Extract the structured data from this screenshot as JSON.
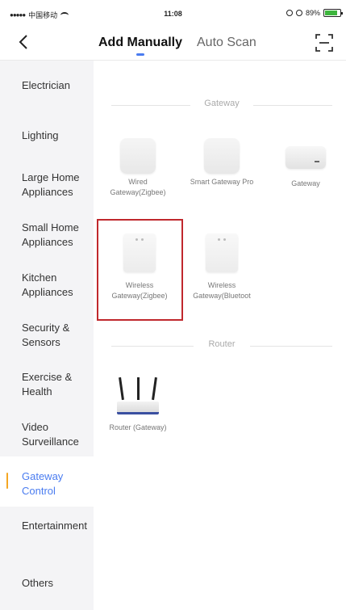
{
  "status_bar": {
    "carrier": "中国移动",
    "time": "11:08",
    "battery": "89%"
  },
  "nav": {
    "tabs": [
      {
        "label": "Add Manually",
        "active": true
      },
      {
        "label": "Auto Scan",
        "active": false
      }
    ],
    "icons": {
      "back": "chevron-left-icon",
      "scan": "scan-frame-icon"
    },
    "accent_color": "#4a7cf0"
  },
  "sidebar": {
    "items": [
      {
        "label": "Electrician",
        "active": false
      },
      {
        "label": "Lighting",
        "active": false
      },
      {
        "label": "Large Home Appliances",
        "active": false
      },
      {
        "label": "Small Home Appliances",
        "active": false
      },
      {
        "label": "Kitchen Appliances",
        "active": false
      },
      {
        "label": "Security & Sensors",
        "active": false
      },
      {
        "label": "Exercise & Health",
        "active": false
      },
      {
        "label": "Video Surveillance",
        "active": false
      },
      {
        "label": "Gateway Control",
        "active": true
      },
      {
        "label": "Entertainment",
        "active": false
      },
      {
        "label": "Others",
        "active": false
      }
    ],
    "active_color": "#4a7cf0",
    "active_marker_color": "#f5a623"
  },
  "sections": [
    {
      "title": "Gateway",
      "devices": [
        {
          "label": "Wired Gateway(Zigbee)",
          "icon": "wired-gateway-device-icon"
        },
        {
          "label": "Smart Gateway Pro",
          "icon": "smart-gateway-device-icon"
        },
        {
          "label": "Gateway",
          "icon": "gateway-device-icon"
        },
        {
          "label": "Wireless Gateway(Zigbee)",
          "icon": "wireless-gateway-zigbee-device-icon",
          "highlighted": true
        },
        {
          "label": "Wireless Gateway(Bluetoot",
          "icon": "wireless-gateway-bluetooth-device-icon"
        }
      ]
    },
    {
      "title": "Router",
      "devices": [
        {
          "label": "Router (Gateway)",
          "icon": "router-device-icon"
        }
      ]
    }
  ],
  "highlight_color": "#c0282d"
}
